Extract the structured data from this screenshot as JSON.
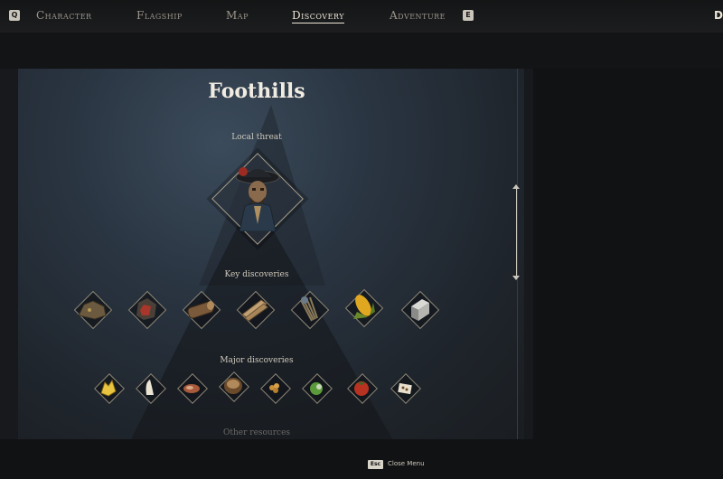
{
  "nav": {
    "left_key": "Q",
    "right_key": "E",
    "tabs": [
      {
        "label": "Character",
        "active": false
      },
      {
        "label": "Flagship",
        "active": false
      },
      {
        "label": "Map",
        "active": false
      },
      {
        "label": "Discovery",
        "active": true
      },
      {
        "label": "Adventure",
        "active": false
      }
    ],
    "corner_letter": "D"
  },
  "region": {
    "title": "Foothills",
    "local_threat_label": "Local threat",
    "local_threat_icon": "pirate-captain-portrait",
    "key_discoveries_label": "Key discoveries",
    "key_discoveries": [
      {
        "icon": "ore-rock-icon"
      },
      {
        "icon": "red-ore-icon"
      },
      {
        "icon": "wood-log-icon"
      },
      {
        "icon": "wood-planks-icon"
      },
      {
        "icon": "fiber-bundle-icon"
      },
      {
        "icon": "corn-icon"
      },
      {
        "icon": "metal-ingot-icon"
      }
    ],
    "major_discoveries_label": "Major discoveries",
    "major_discoveries": [
      {
        "icon": "yellow-crystal-icon"
      },
      {
        "icon": "tooth-icon"
      },
      {
        "icon": "meat-icon"
      },
      {
        "icon": "spice-bowl-icon"
      },
      {
        "icon": "seeds-icon"
      },
      {
        "icon": "green-fruit-icon"
      },
      {
        "icon": "tomato-icon"
      },
      {
        "icon": "salt-pile-icon"
      }
    ],
    "other_resources_label": "Other resources"
  },
  "footer": {
    "close_key": "Esc",
    "close_label": "Close Menu"
  },
  "colors": {
    "accent": "#ece6d8",
    "panel": "#2a3542",
    "background": "#17191c"
  }
}
